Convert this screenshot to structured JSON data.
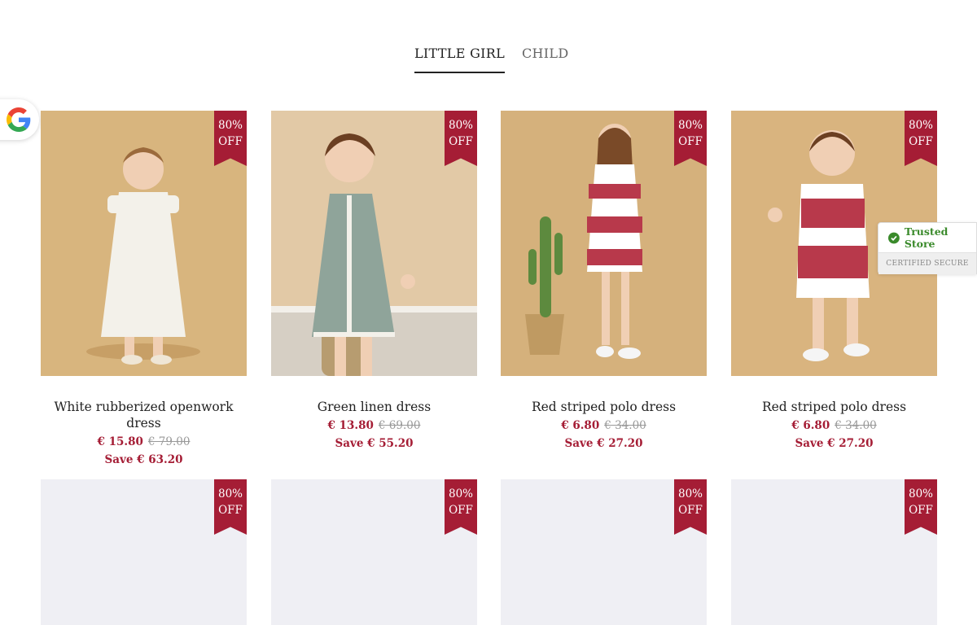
{
  "tabs": [
    {
      "label": "LITTLE GIRL",
      "active": true
    },
    {
      "label": "CHILD",
      "active": false
    }
  ],
  "badge_label_line1": "80%",
  "badge_label_line2": "OFF",
  "products": [
    {
      "name": "White rubberized openwork dress",
      "price": "€ 15.80",
      "old_price": "€ 79.00",
      "save": "Save € 63.20",
      "dress_color": "#f3f1ea",
      "photo_bg": "#d8b57e"
    },
    {
      "name": "Green linen dress",
      "price": "€ 13.80",
      "old_price": "€ 69.00",
      "save": "Save € 55.20",
      "dress_color": "#8fa49a",
      "photo_bg": "#e2c9a6"
    },
    {
      "name": "Red striped polo dress",
      "price": "€ 6.80",
      "old_price": "€ 34.00",
      "save": "Save € 27.20",
      "dress_color": "#b8394b",
      "photo_bg": "#d5b17c"
    },
    {
      "name": "Red striped polo dress",
      "price": "€ 6.80",
      "old_price": "€ 34.00",
      "save": "Save € 27.20",
      "dress_color": "#b8394b",
      "photo_bg": "#d9b47f"
    }
  ],
  "placeholder_count": 4,
  "trusted_store": {
    "label": "Trusted Store",
    "sub": "CERTIFIED SECURE"
  },
  "colors": {
    "accent": "#a51d35",
    "trusted_green": "#3a8a2b",
    "placeholder": "#efeff4"
  },
  "icons": {
    "google": "google-icon",
    "shield_check": "shield-check-icon"
  }
}
